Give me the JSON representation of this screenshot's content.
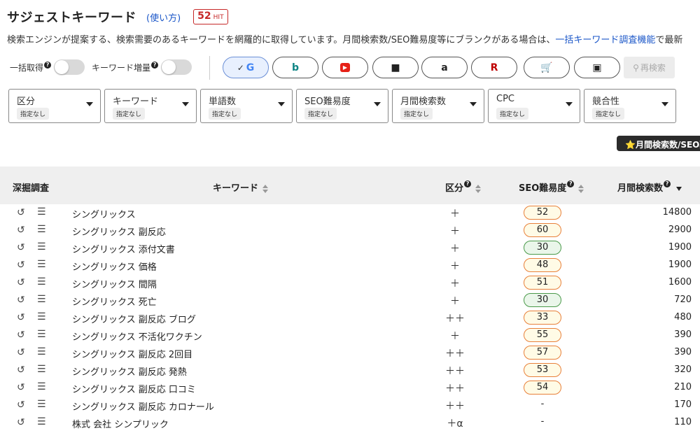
{
  "header": {
    "title": "サジェストキーワード",
    "howto": "(使い方)",
    "hit_count": "52",
    "hit_unit": "HIT"
  },
  "description": {
    "text": "検索エンジンが提案する、検索需要のあるキーワードを網羅的に取得しています。月間検索数/SEO難易度等にブランクがある場合は、",
    "link": "一括キーワード調査機能",
    "tail": "で最新"
  },
  "toggles": [
    {
      "label": "一括取得",
      "on": false
    },
    {
      "label": "キーワード増量",
      "on": false
    }
  ],
  "engines": [
    {
      "name": "google",
      "icon": "google-icon",
      "glyph": "G",
      "color": "#4285f4",
      "check": "✓",
      "active": true
    },
    {
      "name": "bing",
      "icon": "bing-icon",
      "glyph": "b",
      "color": "#0c8484",
      "active": false
    },
    {
      "name": "youtube",
      "icon": "youtube-icon",
      "glyph": "▶",
      "color": "#e62117",
      "active": false
    },
    {
      "name": "video",
      "icon": "video-camera-icon",
      "glyph": "■",
      "color": "#222222",
      "active": false
    },
    {
      "name": "amazon",
      "icon": "amazon-icon",
      "glyph": "a",
      "color": "#222222",
      "active": false
    },
    {
      "name": "rakuten",
      "icon": "rakuten-icon",
      "glyph": "R",
      "color": "#bf0000",
      "active": false
    },
    {
      "name": "shopping",
      "icon": "shopping-cart-icon",
      "glyph": "🛒",
      "color": "#222222",
      "active": false
    },
    {
      "name": "image",
      "icon": "image-icon",
      "glyph": "▣",
      "color": "#222222",
      "active": false
    }
  ],
  "search_button": "再検索",
  "filters": [
    {
      "label": "区分",
      "value": "指定なし"
    },
    {
      "label": "キーワード",
      "value": "指定なし"
    },
    {
      "label": "単語数",
      "value": "指定なし"
    },
    {
      "label": "SEO難易度",
      "value": "指定なし"
    },
    {
      "label": "月間検索数",
      "value": "指定なし"
    },
    {
      "label": "CPC",
      "value": "指定なし"
    },
    {
      "label": "競合性",
      "value": "指定なし"
    }
  ],
  "notice": "⭐月間検索数/SEO難",
  "table": {
    "headers": {
      "dig": "深掘調査",
      "keyword": "キーワード",
      "kubun": "区分",
      "seo": "SEO難易度",
      "volume": "月間検索数"
    },
    "rows": [
      {
        "keyword": "シングリックス",
        "kubun": "＋",
        "seo": "52",
        "seo_level": "mid",
        "volume": "14800"
      },
      {
        "keyword": "シングリックス 副反応",
        "kubun": "＋",
        "seo": "60",
        "seo_level": "mid",
        "volume": "2900"
      },
      {
        "keyword": "シングリックス 添付文書",
        "kubun": "＋",
        "seo": "30",
        "seo_level": "low",
        "volume": "1900"
      },
      {
        "keyword": "シングリックス 価格",
        "kubun": "＋",
        "seo": "48",
        "seo_level": "mid",
        "volume": "1900"
      },
      {
        "keyword": "シングリックス 間隔",
        "kubun": "＋",
        "seo": "51",
        "seo_level": "mid",
        "volume": "1600"
      },
      {
        "keyword": "シングリックス 死亡",
        "kubun": "＋",
        "seo": "30",
        "seo_level": "low",
        "volume": "720"
      },
      {
        "keyword": "シングリックス 副反応 ブログ",
        "kubun": "＋＋",
        "seo": "33",
        "seo_level": "mid",
        "volume": "480"
      },
      {
        "keyword": "シングリックス 不活化ワクチン",
        "kubun": "＋",
        "seo": "55",
        "seo_level": "mid",
        "volume": "390"
      },
      {
        "keyword": "シングリックス 副反応 2回目",
        "kubun": "＋＋",
        "seo": "57",
        "seo_level": "mid",
        "volume": "390"
      },
      {
        "keyword": "シングリックス 副反応 発熱",
        "kubun": "＋＋",
        "seo": "53",
        "seo_level": "mid",
        "volume": "320"
      },
      {
        "keyword": "シングリックス 副反応 口コミ",
        "kubun": "＋＋",
        "seo": "54",
        "seo_level": "mid",
        "volume": "210"
      },
      {
        "keyword": "シングリックス 副反応 カロナール",
        "kubun": "＋＋",
        "seo": "-",
        "seo_level": "none",
        "volume": "170"
      },
      {
        "keyword": "株式 会社 シンプリック",
        "kubun": "＋α",
        "seo": "-",
        "seo_level": "none",
        "volume": "110"
      }
    ]
  }
}
